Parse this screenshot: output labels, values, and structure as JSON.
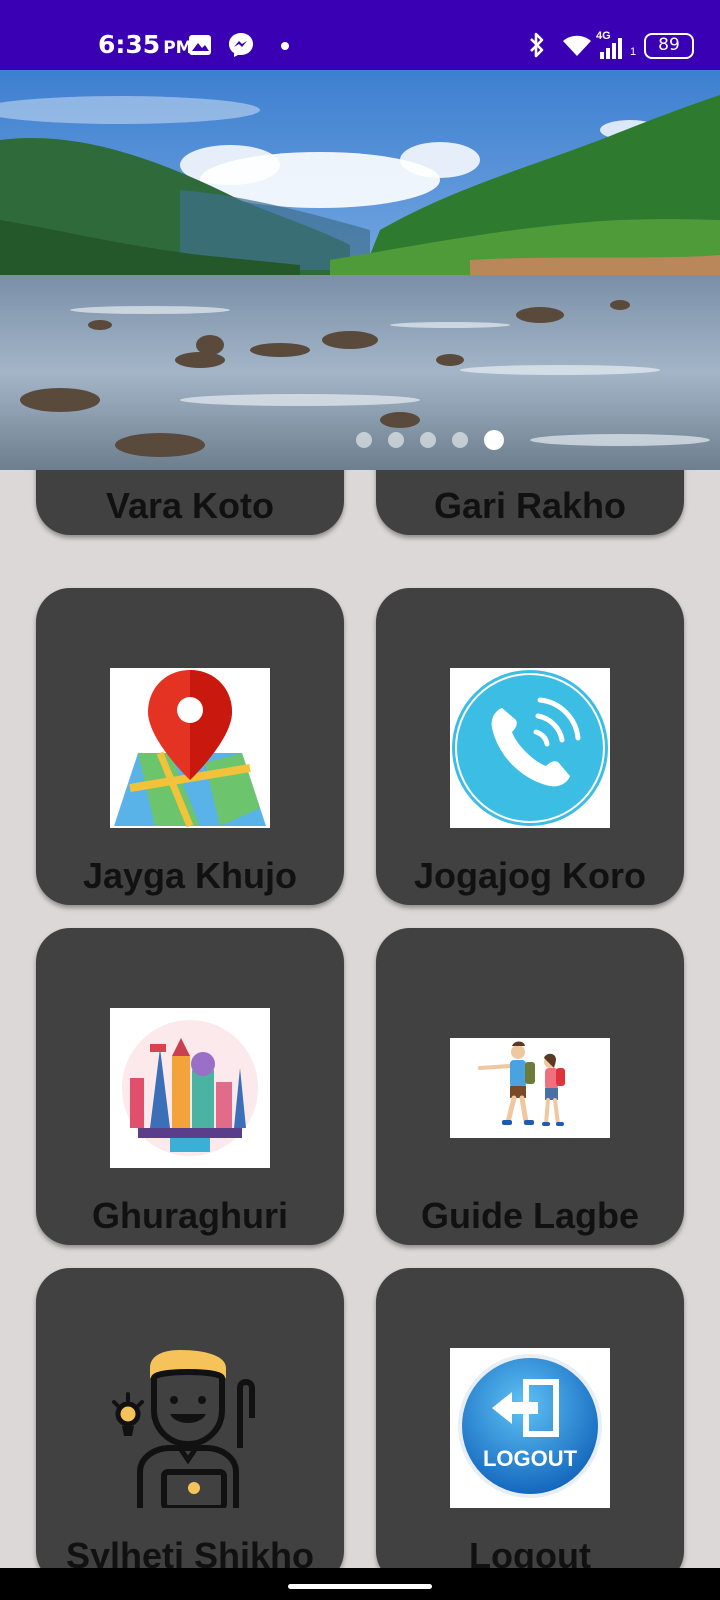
{
  "status_bar": {
    "time": "6:35",
    "ampm": "PM",
    "network": "4G",
    "sim_slot": "1",
    "battery": "89",
    "icons": [
      "gallery-icon",
      "messenger-icon",
      "notification-dot-icon",
      "bluetooth-icon",
      "wifi-icon",
      "signal-icon",
      "battery-icon"
    ]
  },
  "banner": {
    "image": "river-landscape",
    "slides": 5,
    "active_slide": 5
  },
  "menu": {
    "items": [
      {
        "label": "Vara Koto",
        "icon": "fare-icon"
      },
      {
        "label": "Gari Rakho",
        "icon": "car-booking-icon"
      },
      {
        "label": "Jayga Khujo",
        "icon": "map-pin-icon"
      },
      {
        "label": "Jogajog Koro",
        "icon": "phone-call-icon"
      },
      {
        "label": "Ghuraghuri",
        "icon": "landmarks-icon"
      },
      {
        "label": "Guide Lagbe",
        "icon": "tour-guide-icon"
      },
      {
        "label": "Sylheti Shikho",
        "icon": "learner-icon"
      },
      {
        "label": "Logout",
        "icon": "logout-icon"
      }
    ]
  },
  "colors": {
    "status_bar": "#3a00b3",
    "background": "#dcd8d8",
    "card": "#414141",
    "label": "#111111"
  }
}
